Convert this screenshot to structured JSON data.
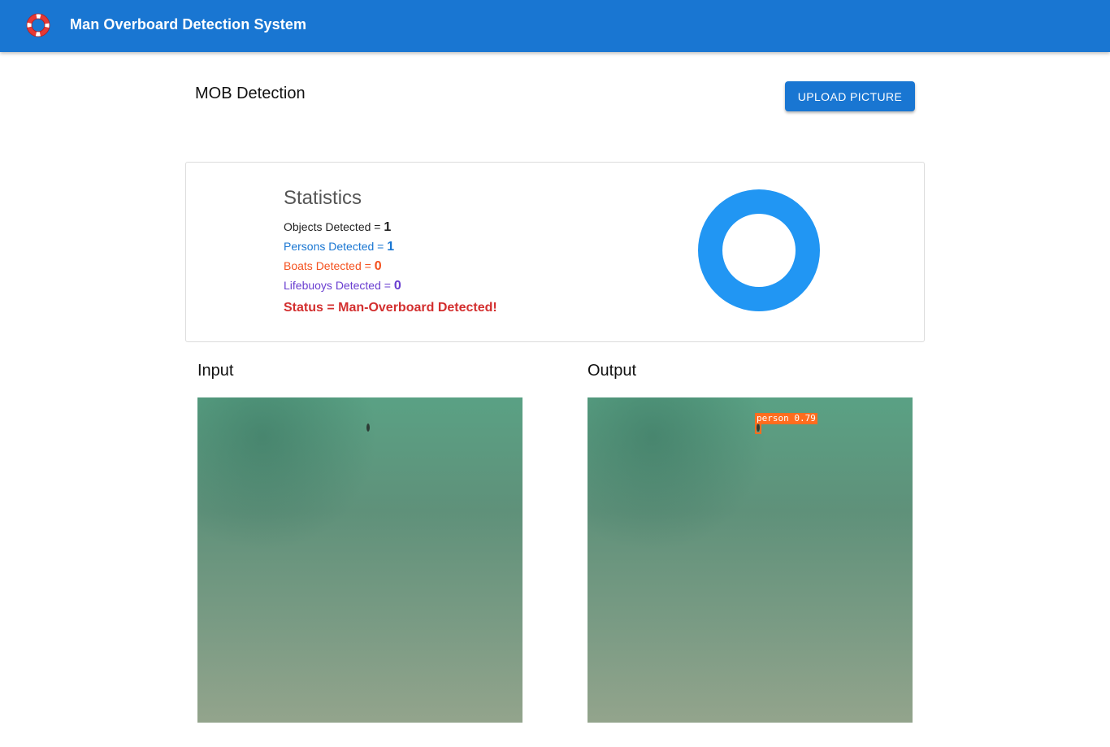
{
  "app": {
    "title": "Man Overboard Detection System",
    "logo_icon": "lifebuoy-icon"
  },
  "main": {
    "heading": "MOB Detection",
    "upload_button": "UPLOAD PICTURE"
  },
  "statistics": {
    "title": "Statistics",
    "objects_label": "Objects Detected = ",
    "objects_value": "1",
    "persons_label": "Persons Detected = ",
    "persons_value": "1",
    "boats_label": "Boats Detected = ",
    "boats_value": "0",
    "lifebuoys_label": "Lifebuoys Detected = ",
    "lifebuoys_value": "0",
    "status": "Status = Man-Overboard Detected!",
    "colors": {
      "objects": "#222222",
      "persons": "#1976d2",
      "boats": "#f4511e",
      "lifebuoys": "#6a3fd0",
      "status": "#d32f2f",
      "donut": "#2196f3"
    }
  },
  "chart_data": {
    "type": "pie",
    "categories": [
      "Persons",
      "Boats",
      "Lifebuoys"
    ],
    "values": [
      1,
      0,
      0
    ]
  },
  "panels": {
    "input_label": "Input",
    "output_label": "Output",
    "detection_label": "person 0.79"
  }
}
